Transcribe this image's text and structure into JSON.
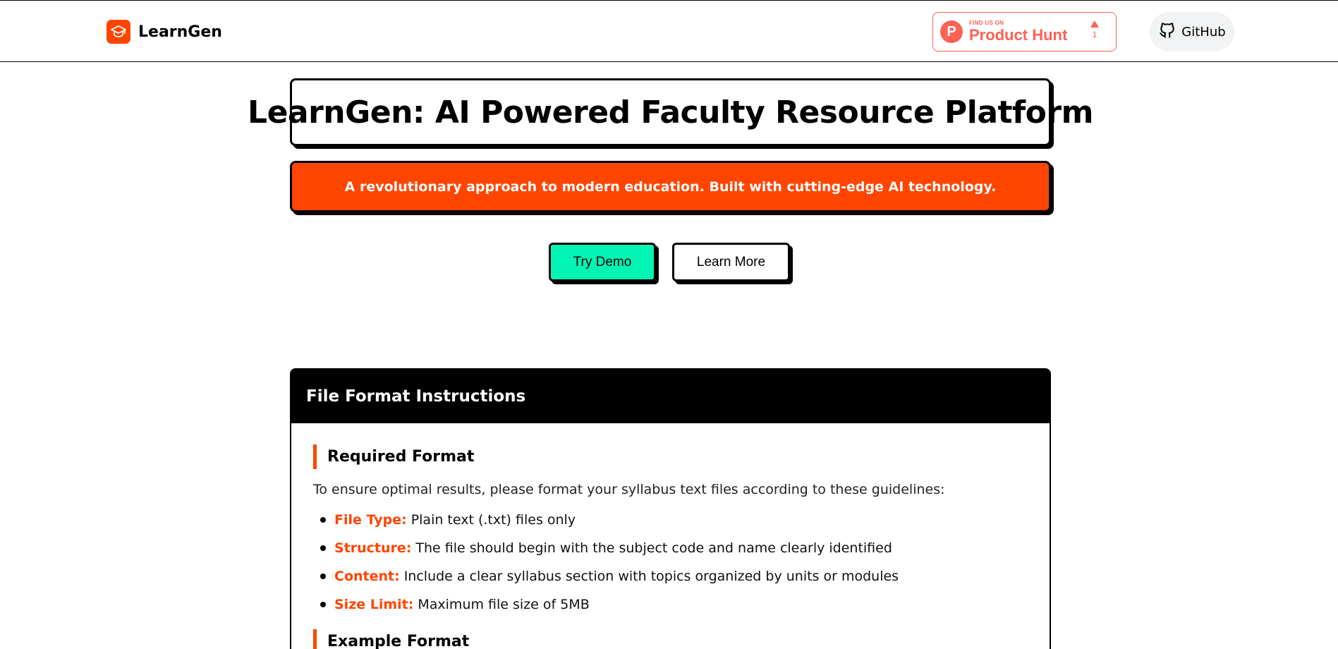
{
  "nav": {
    "brand_name": "LearnGen",
    "product_hunt": {
      "small": "FIND US ON",
      "big": "Product Hunt",
      "count": "1"
    },
    "github_label": "GitHub"
  },
  "hero": {
    "title": "LearnGen: AI Powered Faculty Resource Platform",
    "subtitle": "A revolutionary approach to modern education. Built with cutting-edge AI technology.",
    "try_demo_label": "Try Demo",
    "learn_more_label": "Learn More"
  },
  "instructions": {
    "title": "File Format Instructions",
    "required_format_title": "Required Format",
    "intro": "To ensure optimal results, please format your syllabus text files according to these guidelines:",
    "items": [
      {
        "key": "File Type:",
        "text": "Plain text (.txt) files only"
      },
      {
        "key": "Structure:",
        "text": "The file should begin with the subject code and name clearly identified"
      },
      {
        "key": "Content:",
        "text": "Include a clear syllabus section with topics organized by units or modules"
      },
      {
        "key": "Size Limit:",
        "text": "Maximum file size of 5MB"
      }
    ],
    "example_format_title": "Example Format"
  },
  "colors": {
    "accent": "#ff4500",
    "demo_button": "#00f5b4",
    "product_hunt": "#ff6154"
  },
  "icons": {
    "brand": "graduation-cap-icon",
    "github": "github-icon",
    "product_hunt": "product-hunt-icon"
  }
}
